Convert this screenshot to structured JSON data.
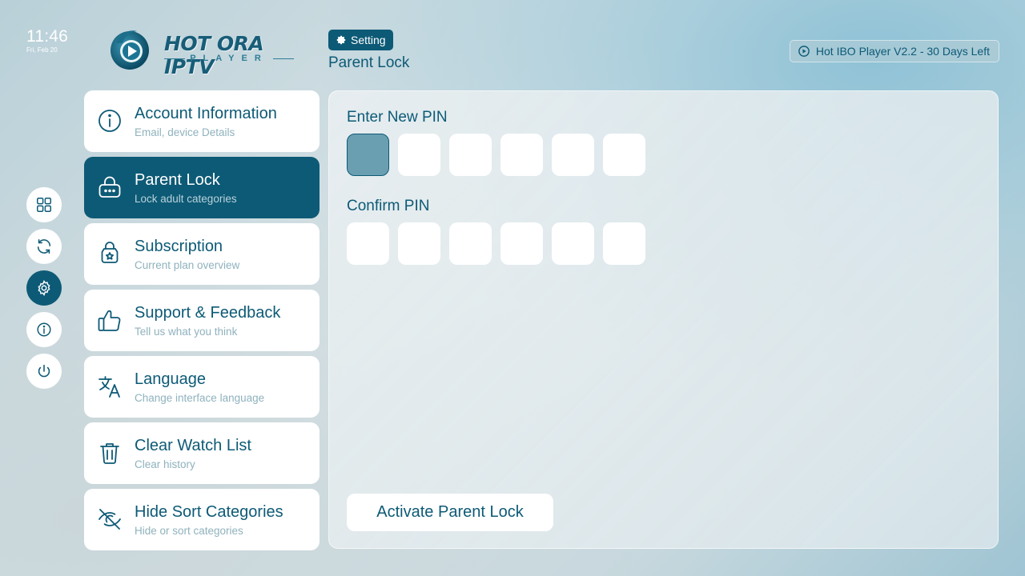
{
  "clock": {
    "time": "11:46",
    "date": "Fri, Feb 20"
  },
  "logo": {
    "brand": "HOT ORA IPTV",
    "sub": "PLAYER"
  },
  "header": {
    "chip_label": "Setting",
    "chip_icon": "gear-icon",
    "page_title": "Parent Lock",
    "version_text": "Hot IBO Player V2.2 - 30 Days Left",
    "version_icon": "play-logo-icon"
  },
  "rail": {
    "items": [
      {
        "name": "apps-grid-icon",
        "active": false
      },
      {
        "name": "refresh-icon",
        "active": false
      },
      {
        "name": "settings-icon",
        "active": true
      },
      {
        "name": "info-icon",
        "active": false
      },
      {
        "name": "power-icon",
        "active": false
      }
    ]
  },
  "menu": {
    "items": [
      {
        "title": "Account Information",
        "subtitle": "Email, device Details",
        "icon": "info-circle-icon",
        "active": false
      },
      {
        "title": "Parent Lock",
        "subtitle": "Lock adult categories",
        "icon": "lock-icon",
        "active": true
      },
      {
        "title": "Subscription",
        "subtitle": "Current plan overview",
        "icon": "subscription-icon",
        "active": false
      },
      {
        "title": "Support & Feedback",
        "subtitle": "Tell us what you think",
        "icon": "thumbs-up-icon",
        "active": false
      },
      {
        "title": "Language",
        "subtitle": "Change interface language",
        "icon": "translate-icon",
        "active": false
      },
      {
        "title": "Clear Watch List",
        "subtitle": "Clear history",
        "icon": "trash-icon",
        "active": false
      },
      {
        "title": "Hide Sort Categories",
        "subtitle": "Hide  or sort categories",
        "icon": "eye-off-icon",
        "active": false
      }
    ]
  },
  "panel": {
    "new_pin_label": "Enter New PIN",
    "confirm_pin_label": "Confirm PIN",
    "pin_length": 6,
    "activate_label": "Activate Parent Lock"
  },
  "colors": {
    "accent": "#0d5a76",
    "focus": "#6a9fb1",
    "muted": "#8fb2bd"
  }
}
